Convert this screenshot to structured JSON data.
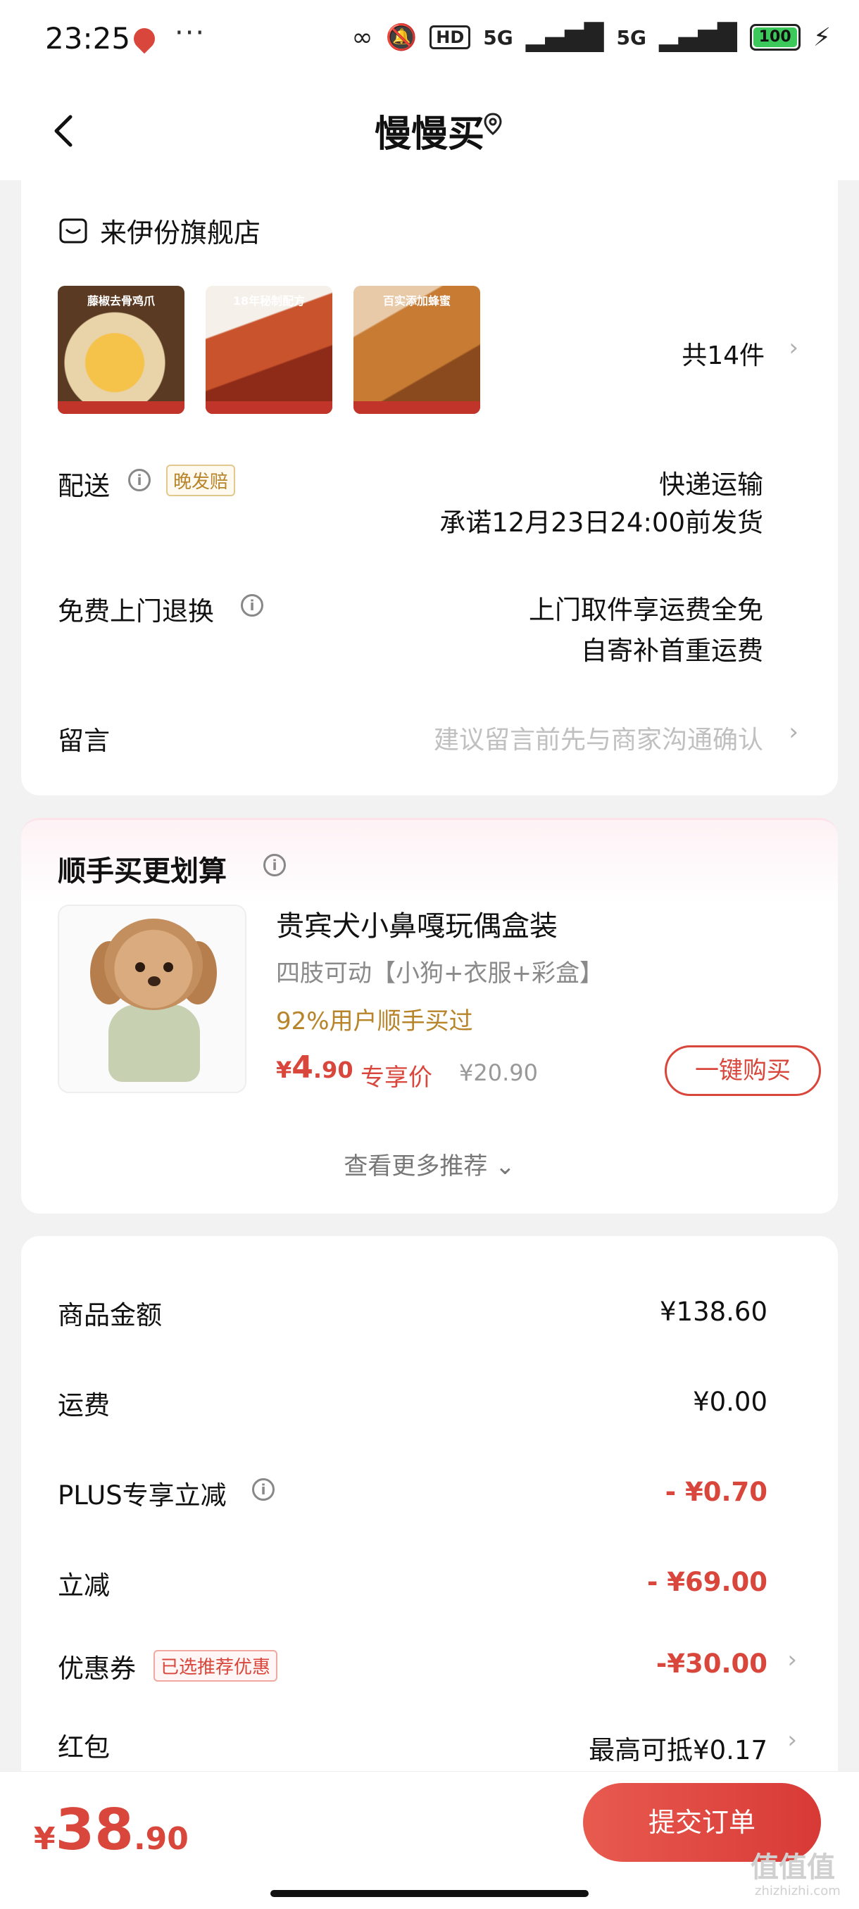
{
  "status_bar": {
    "time": "23:25",
    "more": "···",
    "hd_tag": "HD",
    "signal1": "5G",
    "signal2": "5G",
    "battery": "100"
  },
  "header": {
    "title": "慢慢买",
    "back_icon": "back-chevron-icon",
    "location_icon": "location-pin-icon"
  },
  "order": {
    "store_name": "来伊份旗舰店",
    "thumb_captions": [
      "藤椒去骨鸡爪",
      "18年秘制配方",
      "百实添加蜂蜜"
    ],
    "item_count": "共14件",
    "delivery_label": "配送",
    "delivery_tag": "晚发赔",
    "delivery_method": "快递运输",
    "delivery_promise": "承诺12月23日24:00前发货",
    "return_label": "免费上门退换",
    "return_line1": "上门取件享运费全免",
    "return_line2": "自寄补首重运费",
    "message_label": "留言",
    "message_hint": "建议留言前先与商家沟通确认"
  },
  "recommend": {
    "title": "顺手买更划算",
    "product_title": "贵宾犬小鼻嘎玩偶盒装",
    "product_spec": "四肢可动【小狗+衣服+彩盒】",
    "social_proof": "92%用户顺手买过",
    "price_currency": "¥",
    "price_int": "4",
    "price_dec": ".90",
    "price_tag": "专享价",
    "original_price": "¥20.90",
    "buy_button": "一键购买",
    "more_link": "查看更多推荐 ⌄"
  },
  "summary": {
    "goods_label": "商品金额",
    "goods_value": "¥138.60",
    "shipping_label": "运费",
    "shipping_value": "¥0.00",
    "plus_label": "PLUS专享立减",
    "plus_value": "- ¥0.70",
    "discount_label": "立减",
    "discount_value": "- ¥69.00",
    "coupon_label": "优惠券",
    "coupon_tag": "已选推荐优惠",
    "coupon_value": "-¥30.00",
    "redpacket_label": "红包",
    "redpacket_value": "最高可抵¥0.17"
  },
  "bottom": {
    "total_currency": "¥",
    "total_int": "38",
    "total_dec": ".90",
    "submit_button": "提交订单"
  },
  "watermark": {
    "logo": "值值值",
    "site": "zhizhizhi.com"
  },
  "colors": {
    "accent_red": "#d9463b",
    "gold": "#b8842a",
    "background": "#f2f2f2"
  }
}
